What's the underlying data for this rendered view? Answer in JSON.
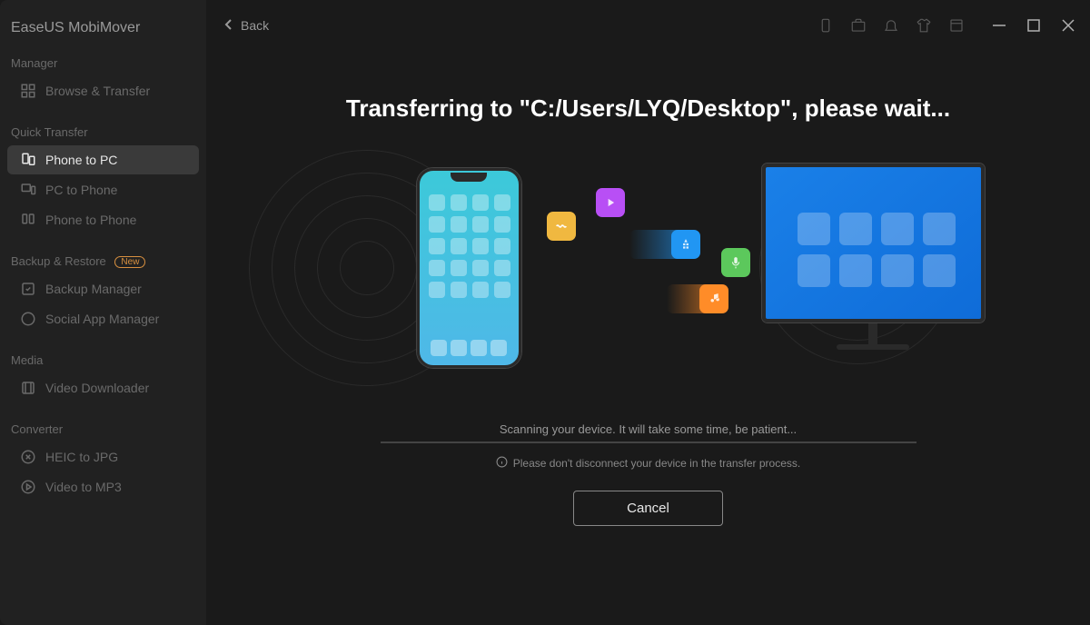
{
  "app_title": "EaseUS MobiMover",
  "back_label": "Back",
  "sidebar": {
    "sections": [
      {
        "title": "Manager",
        "items": [
          {
            "label": "Browse & Transfer",
            "icon": "grid-icon"
          }
        ]
      },
      {
        "title": "Quick Transfer",
        "items": [
          {
            "label": "Phone to PC",
            "icon": "phone-to-pc-icon",
            "active": true
          },
          {
            "label": "PC to Phone",
            "icon": "pc-to-phone-icon"
          },
          {
            "label": "Phone to Phone",
            "icon": "phone-to-phone-icon"
          }
        ]
      },
      {
        "title": "Backup & Restore",
        "badge": "New",
        "items": [
          {
            "label": "Backup Manager",
            "icon": "backup-icon"
          },
          {
            "label": "Social App Manager",
            "icon": "chat-icon"
          }
        ]
      },
      {
        "title": "Media",
        "items": [
          {
            "label": "Video Downloader",
            "icon": "film-icon"
          }
        ]
      },
      {
        "title": "Converter",
        "items": [
          {
            "label": "HEIC to JPG",
            "icon": "image-icon"
          },
          {
            "label": "Video to MP3",
            "icon": "video-to-audio-icon"
          }
        ]
      }
    ]
  },
  "main": {
    "headline": "Transferring to \"C:/Users/LYQ/Desktop\", please wait...",
    "progress_text": "Scanning your device. It will take some time, be patient...",
    "warning_text": "Please don't disconnect your device in the transfer process.",
    "cancel_label": "Cancel"
  }
}
